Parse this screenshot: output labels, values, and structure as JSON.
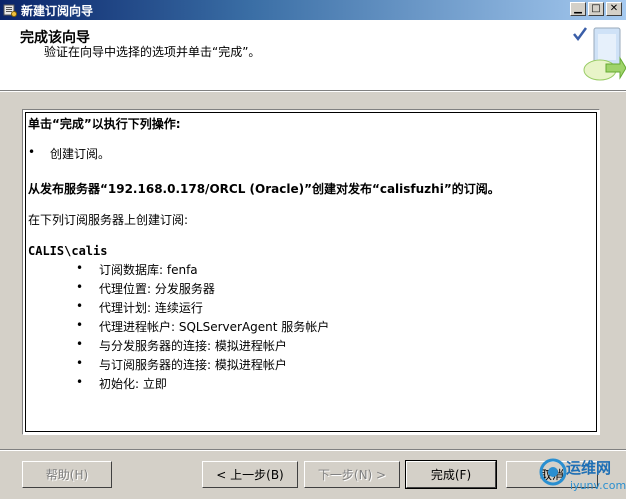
{
  "window": {
    "title": "新建订阅向导",
    "controls": {
      "minimize": "▁",
      "maximize": "□",
      "close": "✕"
    }
  },
  "header": {
    "title": "完成该向导",
    "subtitle": "验证在向导中选择的选项并单击“完成”。"
  },
  "content": {
    "intro": "单击“完成”以执行下列操作:",
    "action_bullet": "•",
    "action": "创建订阅。",
    "publication_line": "从发布服务器“192.168.0.178/ORCL (Oracle)”创建对发布“calisfuzhi”的订阅。",
    "subscriber_intro": "在下列订阅服务器上创建订阅:",
    "subscriber": "CALIS\\calis",
    "details": [
      {
        "bullet": "•",
        "text": "订阅数据库: fenfa"
      },
      {
        "bullet": "•",
        "text": "代理位置: 分发服务器"
      },
      {
        "bullet": "•",
        "text": "代理计划: 连续运行"
      },
      {
        "bullet": "•",
        "text": "代理进程帐户: SQLServerAgent 服务帐户"
      },
      {
        "bullet": "•",
        "text": "与分发服务器的连接: 模拟进程帐户"
      },
      {
        "bullet": "•",
        "text": "与订阅服务器的连接: 模拟进程帐户"
      },
      {
        "bullet": "•",
        "text": "初始化: 立即"
      }
    ]
  },
  "buttons": {
    "help": "帮助(H)",
    "back": "< 上一步(B)",
    "next": "下一步(N) >",
    "finish": "完成(F)",
    "cancel": "取消"
  },
  "watermark": {
    "text": "运维网",
    "url": "iyunv.com"
  },
  "colors": {
    "titlebar_start": "#0a246a",
    "titlebar_end": "#a6caf0",
    "dialog_bg": "#d4d0c8",
    "disabled_text": "#808080"
  }
}
